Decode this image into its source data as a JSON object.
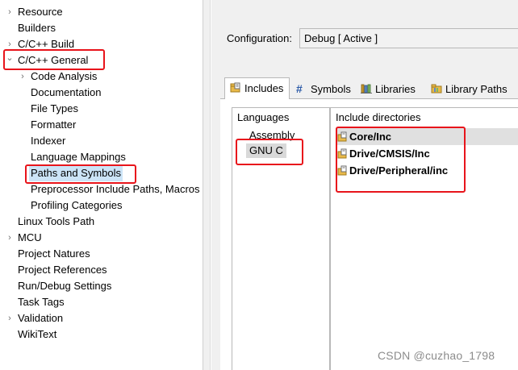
{
  "tree": {
    "items": [
      {
        "label": "Resource",
        "toggle": "›"
      },
      {
        "label": "Builders",
        "toggle": ""
      },
      {
        "label": "C/C++ Build",
        "toggle": "›"
      },
      {
        "label": "C/C++ General",
        "toggle": "⌄"
      },
      {
        "label": "Code Analysis",
        "toggle": "›"
      },
      {
        "label": "Documentation",
        "toggle": ""
      },
      {
        "label": "File Types",
        "toggle": ""
      },
      {
        "label": "Formatter",
        "toggle": ""
      },
      {
        "label": "Indexer",
        "toggle": ""
      },
      {
        "label": "Language Mappings",
        "toggle": ""
      },
      {
        "label": "Paths and Symbols",
        "toggle": ""
      },
      {
        "label": "Preprocessor Include Paths, Macros",
        "toggle": ""
      },
      {
        "label": "Profiling Categories",
        "toggle": ""
      },
      {
        "label": "Linux Tools Path",
        "toggle": ""
      },
      {
        "label": "MCU",
        "toggle": "›"
      },
      {
        "label": "Project Natures",
        "toggle": ""
      },
      {
        "label": "Project References",
        "toggle": ""
      },
      {
        "label": "Run/Debug Settings",
        "toggle": ""
      },
      {
        "label": "Task Tags",
        "toggle": ""
      },
      {
        "label": "Validation",
        "toggle": "›"
      },
      {
        "label": "WikiText",
        "toggle": ""
      }
    ]
  },
  "configuration": {
    "label": "Configuration:",
    "value": "Debug  [ Active ]"
  },
  "tabs": [
    {
      "label": "Includes",
      "icon": "includes-icon"
    },
    {
      "label": "Symbols",
      "icon": "symbols-hash-icon"
    },
    {
      "label": "Libraries",
      "icon": "libraries-icon"
    },
    {
      "label": "Library Paths",
      "icon": "library-paths-icon"
    }
  ],
  "languages": {
    "header": "Languages",
    "items": [
      "Assembly",
      "GNU C"
    ]
  },
  "include_directories": {
    "header": "Include directories",
    "items": [
      "Core/Inc",
      "Drive/CMSIS/Inc",
      "Drive/Peripheral/inc"
    ]
  },
  "watermark": "CSDN @cuzhao_1798",
  "colors": {
    "annotation_red": "#e8141b",
    "tree_selection": "#cce4f7",
    "panel_background": "#f0f0f0"
  }
}
